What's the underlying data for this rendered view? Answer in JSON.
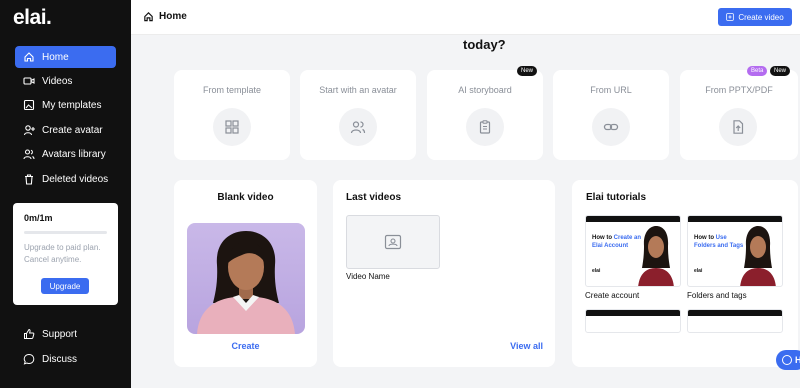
{
  "app": {
    "logo": "elai."
  },
  "sidebar": {
    "items": [
      {
        "label": "Home",
        "icon": "home-icon"
      },
      {
        "label": "Videos",
        "icon": "video-icon"
      },
      {
        "label": "My templates",
        "icon": "templates-icon"
      },
      {
        "label": "Create avatar",
        "icon": "add-user-icon"
      },
      {
        "label": "Avatars library",
        "icon": "users-icon"
      },
      {
        "label": "Deleted videos",
        "icon": "trash-icon"
      }
    ],
    "bottom": [
      {
        "label": "Support",
        "icon": "thumbs-up-icon"
      },
      {
        "label": "Discuss",
        "icon": "chat-icon"
      }
    ],
    "usage": {
      "time": "0m/1m",
      "progress": 0,
      "note_line1": "Upgrade to paid plan.",
      "note_line2": "Cancel anytime.",
      "upgrade_label": "Upgrade"
    }
  },
  "header": {
    "breadcrumb": "Home",
    "create_label": "Create video"
  },
  "main": {
    "heading": "today?",
    "options": [
      {
        "title": "From template",
        "icon": "grid-icon"
      },
      {
        "title": "Start with an avatar",
        "icon": "users-icon"
      },
      {
        "title": "AI storyboard",
        "icon": "clipboard-icon",
        "badge": "New"
      },
      {
        "title": "From URL",
        "icon": "link-icon"
      },
      {
        "title": "From PPTX/PDF",
        "icon": "file-upload-icon",
        "badges": [
          "Beta",
          "New"
        ]
      }
    ],
    "blank": {
      "title": "Blank video",
      "action": "Create"
    },
    "last_videos": {
      "title": "Last videos",
      "video_name": "Video Name",
      "view_all": "View all"
    },
    "tutorials": {
      "title": "Elai tutorials",
      "items": [
        {
          "thumb_plain1": "How to ",
          "thumb_hl1": "Create an",
          "thumb_hl2": "Elai Account",
          "label": "Create account"
        },
        {
          "thumb_plain1": "How to ",
          "thumb_hl1": "Use",
          "thumb_hl2": "Folders and Tags",
          "label": "Folders and tags"
        }
      ],
      "brand": "elai"
    },
    "help_label": "H"
  },
  "colors": {
    "accent": "#3b6cf0",
    "sidebar": "#111111",
    "beta": "#b46cf0"
  }
}
